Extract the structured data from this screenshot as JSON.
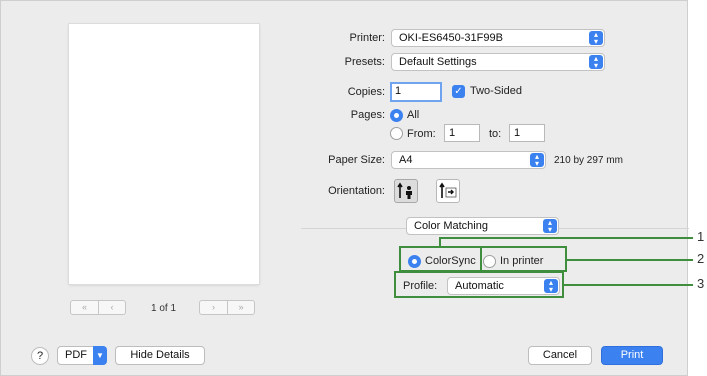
{
  "printer": {
    "label": "Printer:",
    "value": "OKI-ES6450-31F99B"
  },
  "presets": {
    "label": "Presets:",
    "value": "Default Settings"
  },
  "copies": {
    "label": "Copies:",
    "value": "1",
    "two_sided_label": "Two-Sided",
    "two_sided_checked": true
  },
  "pages": {
    "label": "Pages:",
    "all_label": "All",
    "from_label": "From:",
    "from_value": "1",
    "to_label": "to:",
    "to_value": "1",
    "selected": "All"
  },
  "paper_size": {
    "label": "Paper Size:",
    "value": "A4",
    "dimensions": "210 by 297 mm"
  },
  "orientation": {
    "label": "Orientation:",
    "selected": "portrait"
  },
  "section_popup": {
    "value": "Color Matching"
  },
  "color_matching": {
    "colorsync_label": "ColorSync",
    "in_printer_label": "In printer",
    "selected": "ColorSync"
  },
  "profile": {
    "label": "Profile:",
    "value": "Automatic"
  },
  "preview": {
    "page_count": "1 of 1",
    "first_icon": "«",
    "prev_icon": "‹",
    "next_icon": "›",
    "last_icon": "»"
  },
  "bottom_bar": {
    "help_label": "?",
    "pdf_label": "PDF",
    "hide_details_label": "Hide Details",
    "cancel_label": "Cancel",
    "print_label": "Print"
  },
  "callouts": [
    "1",
    "2",
    "3"
  ],
  "accent_color": "#3b82f0",
  "callout_color": "#3e8e3e"
}
